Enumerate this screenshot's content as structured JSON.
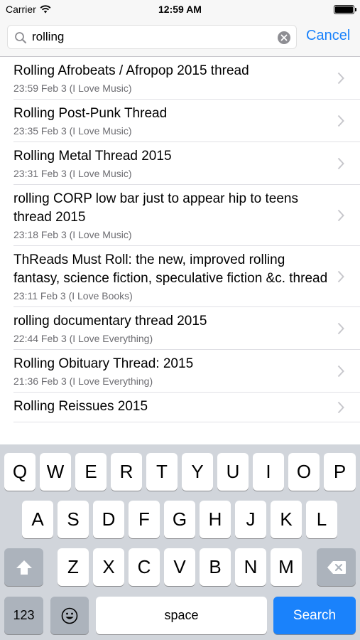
{
  "status_bar": {
    "carrier": "Carrier",
    "time": "12:59 AM"
  },
  "search": {
    "query": "rolling",
    "cancel_label": "Cancel"
  },
  "results": [
    {
      "title": "Rolling Afrobeats / Afropop 2015 thread",
      "meta": "23:59 Feb 3 (I Love Music)"
    },
    {
      "title": "Rolling Post-Punk Thread",
      "meta": "23:35 Feb 3 (I Love Music)"
    },
    {
      "title": "Rolling Metal Thread 2015",
      "meta": "23:31 Feb 3 (I Love Music)"
    },
    {
      "title": "rolling CORP low bar just to appear hip to teens thread 2015",
      "meta": "23:18 Feb 3 (I Love Music)"
    },
    {
      "title": "ThReads Must Roll: the new, improved rolling fantasy, science fiction, speculative fiction &c. thread",
      "meta": "23:11 Feb 3 (I Love Books)"
    },
    {
      "title": "rolling documentary thread 2015",
      "meta": "22:44 Feb 3 (I Love Everything)"
    },
    {
      "title": "Rolling Obituary Thread: 2015",
      "meta": "21:36 Feb 3 (I Love Everything)"
    },
    {
      "title": "Rolling Reissues 2015",
      "meta": ""
    }
  ],
  "keyboard": {
    "row1": [
      "Q",
      "W",
      "E",
      "R",
      "T",
      "Y",
      "U",
      "I",
      "O",
      "P"
    ],
    "row2": [
      "A",
      "S",
      "D",
      "F",
      "G",
      "H",
      "J",
      "K",
      "L"
    ],
    "row3": [
      "Z",
      "X",
      "C",
      "V",
      "B",
      "N",
      "M"
    ],
    "numbers_label": "123",
    "space_label": "space",
    "search_label": "Search",
    "shift_icon": "shift-icon",
    "delete_icon": "delete-icon",
    "emoji_icon": "emoji-icon"
  },
  "colors": {
    "accent": "#1a82fb",
    "keyboard_bg": "#d1d5db",
    "meta_text": "#6d6d72"
  }
}
